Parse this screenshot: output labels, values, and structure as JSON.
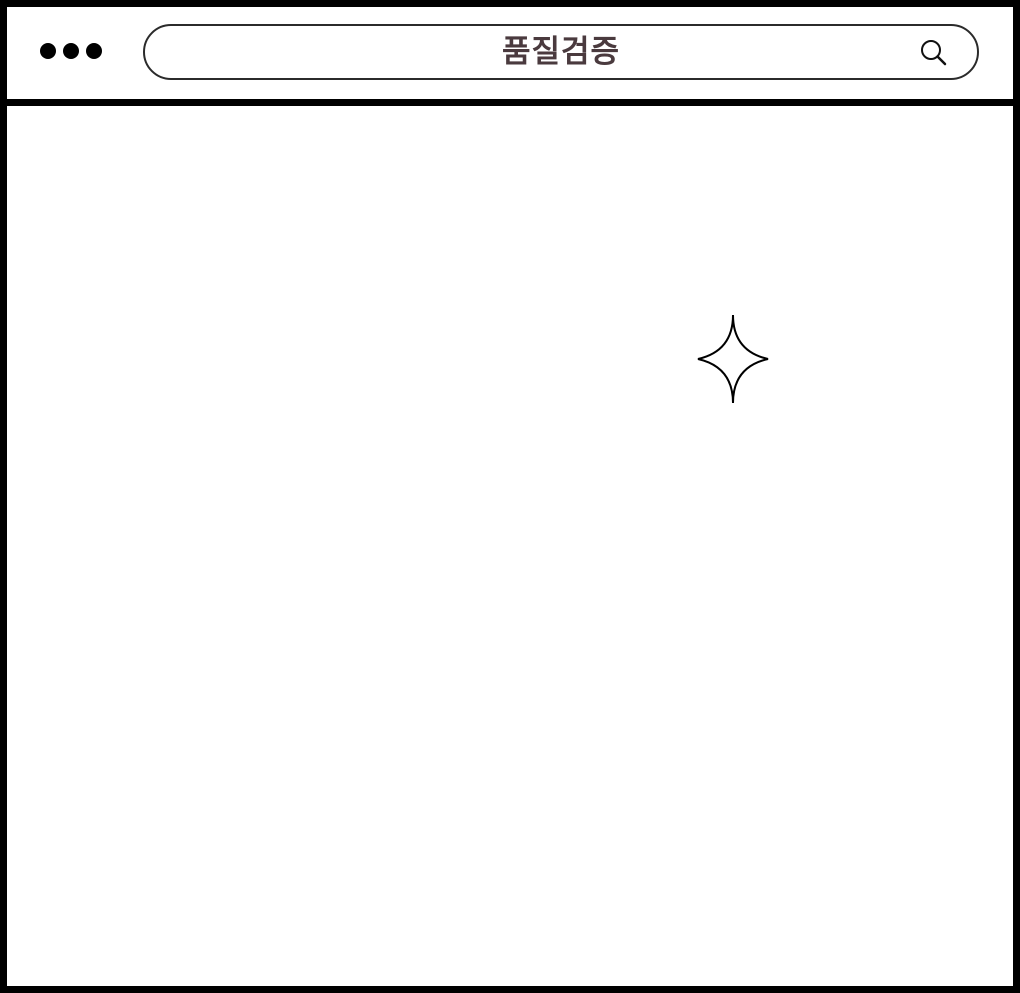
{
  "window": {
    "search": {
      "query": "품질검증",
      "icon": "search-icon"
    },
    "controls": {
      "icon": "more-dots-icon"
    }
  },
  "content": {
    "decoration_icon": "sparkle-icon"
  },
  "colors": {
    "frame": "#000000",
    "background": "#ffffff",
    "search_text": "#4a3a3e"
  }
}
